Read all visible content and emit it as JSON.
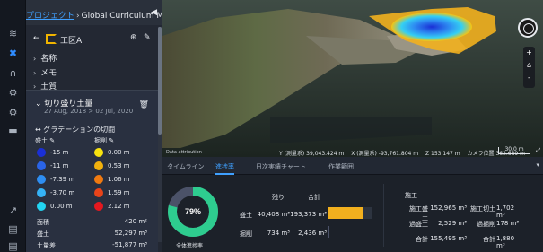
{
  "rail": {
    "icons": [
      "layers-icon",
      "tools-icon",
      "network-icon",
      "settings-icon",
      "vehicle-icon",
      "folder-icon",
      "share-icon",
      "document-icon",
      "report-icon"
    ]
  },
  "breadcrumb": {
    "project": "プロジェクト",
    "separator": "›",
    "title": "Global Curriculum M...",
    "caret": "⌄",
    "collapse": "◀"
  },
  "area": {
    "name": "工区A"
  },
  "properties": [
    "名称",
    "メモ",
    "土質"
  ],
  "cutfill": {
    "title": "切り盛り土量",
    "date": "27 Aug, 2018 > 02 Jul, 2020",
    "gradient_title": "グラデーションの切闘",
    "fill_header": "盛土",
    "cut_header": "掘削",
    "fill_levels": [
      {
        "color": "#1a2fd6",
        "value": "-15 m"
      },
      {
        "color": "#2a64e8",
        "value": "-11 m"
      },
      {
        "color": "#2e8ef2",
        "value": "-7.39 m"
      },
      {
        "color": "#35b2f5",
        "value": "-3.70 m"
      },
      {
        "color": "#22d4f2",
        "value": "0.00 m"
      }
    ],
    "cut_levels": [
      {
        "color": "#f7e20f",
        "value": "0.00 m"
      },
      {
        "color": "#f2b10d",
        "value": "0.53 m"
      },
      {
        "color": "#f07a10",
        "value": "1.06 m"
      },
      {
        "color": "#e9441a",
        "value": "1.59 m"
      },
      {
        "color": "#e5181f",
        "value": "2.12 m"
      }
    ],
    "stats": [
      {
        "label": "面積",
        "value": "420 m²"
      },
      {
        "label": "盛土",
        "value": "52,297 m³"
      },
      {
        "label": "土量差",
        "value": "-51,877 m³"
      }
    ]
  },
  "viewer": {
    "attribution": "Data attribution",
    "coords": [
      "Y (測量系) 39,043.424 m",
      "X (測量系) -93,761.804 m",
      "Z 153.147 m",
      "カメラ位置 362.689 m"
    ],
    "scale": "30.0 m",
    "zoom_in": "+",
    "home": "⌂",
    "zoom_out": "-"
  },
  "tabs": [
    "タイムライン",
    "進捗率",
    "日次実績チャート",
    "作業範囲"
  ],
  "progress": {
    "percent_label": "79%",
    "percent": 79,
    "caption": "全体進捗率",
    "head_remaining": "残り",
    "head_total": "合計",
    "rows": [
      {
        "label": "盛土",
        "remaining": "40,408 m³",
        "total": "193,373 m³",
        "fraction": 0.79
      },
      {
        "label": "掘削",
        "remaining": "734 m³",
        "total": "2,436 m³",
        "fraction": 0.03
      }
    ],
    "colors": {
      "done": "#2ecc8f",
      "remaining": "#4b5268",
      "bar": "#f2b01e"
    }
  },
  "summary": {
    "title": "施工",
    "rows": [
      {
        "l1": "施工盛土",
        "v1": "152,965 m³",
        "l2": "施工切土",
        "v2": "1,702 m³"
      },
      {
        "l1": "過盛土",
        "v1": "2,529 m³",
        "l2": "過掘削",
        "v2": "178 m³"
      },
      {
        "l1": "合計",
        "v1": "155,495 m³",
        "l2": "合計",
        "v2": "1,880 m³"
      }
    ]
  }
}
